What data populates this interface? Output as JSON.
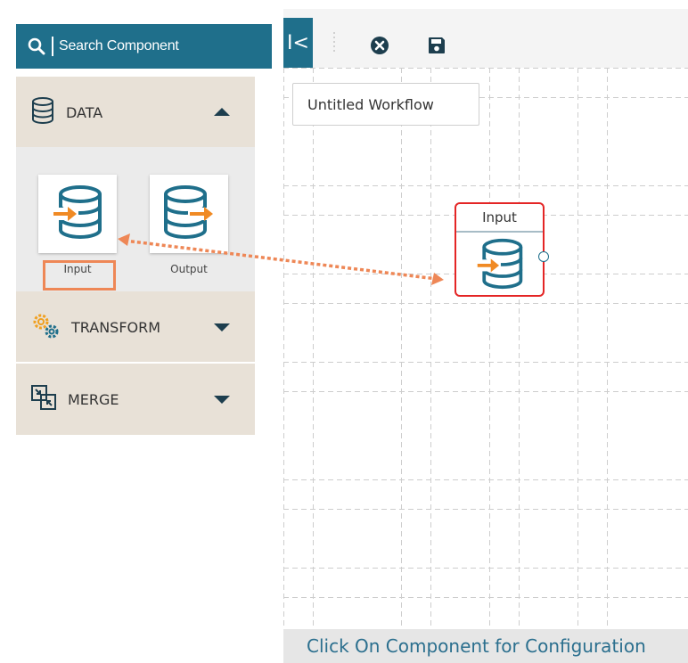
{
  "sidebar": {
    "search_label": "Search Component",
    "categories": [
      {
        "label": "DATA",
        "icon": "database-icon",
        "expanded": true
      },
      {
        "label": "TRANSFORM",
        "icon": "gears-icon",
        "expanded": false
      },
      {
        "label": "MERGE",
        "icon": "merge-icon",
        "expanded": false
      }
    ],
    "components": [
      {
        "label": "Input",
        "icon": "database-input-icon"
      },
      {
        "label": "Output",
        "icon": "database-output-icon"
      }
    ]
  },
  "toolbar": {
    "collapse_label": "I<",
    "close_icon": "close-circle-icon",
    "save_icon": "save-icon"
  },
  "canvas": {
    "workflow_name": "Untitled Workflow",
    "node_title": "Input",
    "footer_text": "Click On Component for Configuration"
  },
  "colors": {
    "primary": "#1f6f8b",
    "category_bg": "#e8e1d7",
    "node_border": "#e42525",
    "highlight": "#ee8756",
    "db_orange": "#f08a24"
  }
}
